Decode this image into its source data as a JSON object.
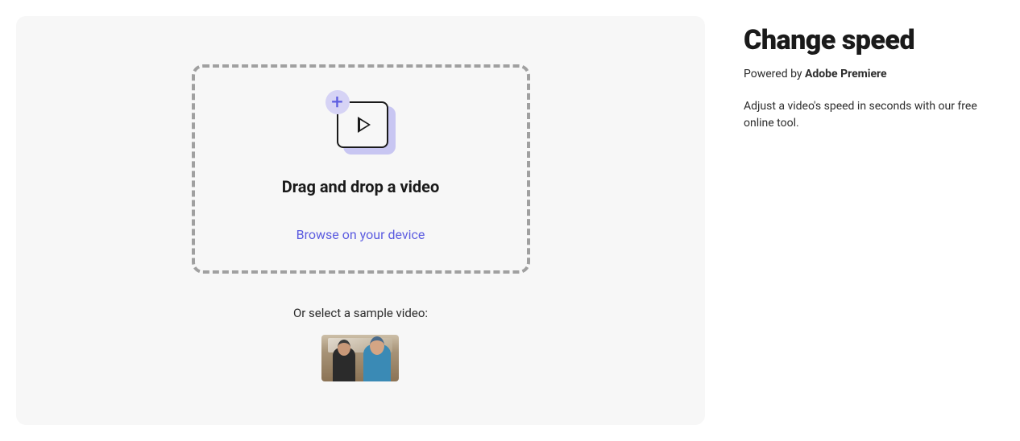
{
  "dropzone": {
    "title": "Drag and drop a video",
    "browse_label": "Browse on your device"
  },
  "sample": {
    "label": "Or select a sample video:"
  },
  "sidebar": {
    "title": "Change speed",
    "powered_prefix": "Powered by ",
    "powered_brand": "Adobe Premiere",
    "description": "Adjust a video's speed in seconds with our free online tool."
  }
}
